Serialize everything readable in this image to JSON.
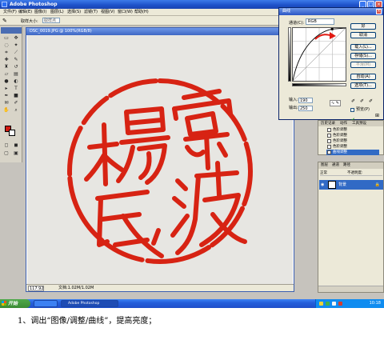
{
  "app": {
    "title": "Adobe Photoshop",
    "menu": [
      "文件(F)",
      "编辑(E)",
      "图像(I)",
      "图层(L)",
      "选择(S)",
      "滤镜(T)",
      "视图(V)",
      "窗口(W)",
      "帮助(H)"
    ]
  },
  "options_bar": {
    "label": "取样大小:",
    "value": "取样点"
  },
  "document": {
    "title": "DSC_0019.JPG @ 100%(RGB/8)",
    "zoom": "117.92",
    "status_info": "文档:1.02M/1.02M"
  },
  "curves": {
    "title": "曲线",
    "channel_label": "通道(C):",
    "channel_value": "RGB",
    "input_label": "输入:",
    "input_value": "190",
    "output_label": "输出:",
    "output_value": "250",
    "buttons": [
      "好",
      "取消",
      "载入(L)...",
      "存储(S)...",
      "平滑(M)",
      "自动(A)",
      "选项(T)..."
    ],
    "preview_label": "预览(P)",
    "preview_checked": true,
    "curve_points": [
      [
        0,
        0
      ],
      [
        190,
        250
      ],
      [
        255,
        255
      ]
    ],
    "accent_color": "#e11a12"
  },
  "history": {
    "tabs": [
      "历史记录",
      "动作",
      "工具预设"
    ],
    "rows": [
      "色阶调整",
      "色阶调整",
      "色阶调整",
      "色阶调整",
      "曲线调整"
    ],
    "selected_index": 4
  },
  "layers": {
    "tabs": [
      "图层",
      "通道",
      "路径"
    ],
    "layer_name": "背景",
    "mode_label": "正常",
    "opacity_label": "不透明度:"
  },
  "taskbar": {
    "start_label": "开始",
    "items": [
      "",
      "Adobe Photoshop"
    ],
    "clock": "10:18"
  },
  "seal": {
    "color": "#d72313",
    "characters": [
      "寧",
      "波",
      "楊",
      "氏"
    ]
  },
  "caption": "1、调出“图像/调整/曲线”，提高亮度；"
}
